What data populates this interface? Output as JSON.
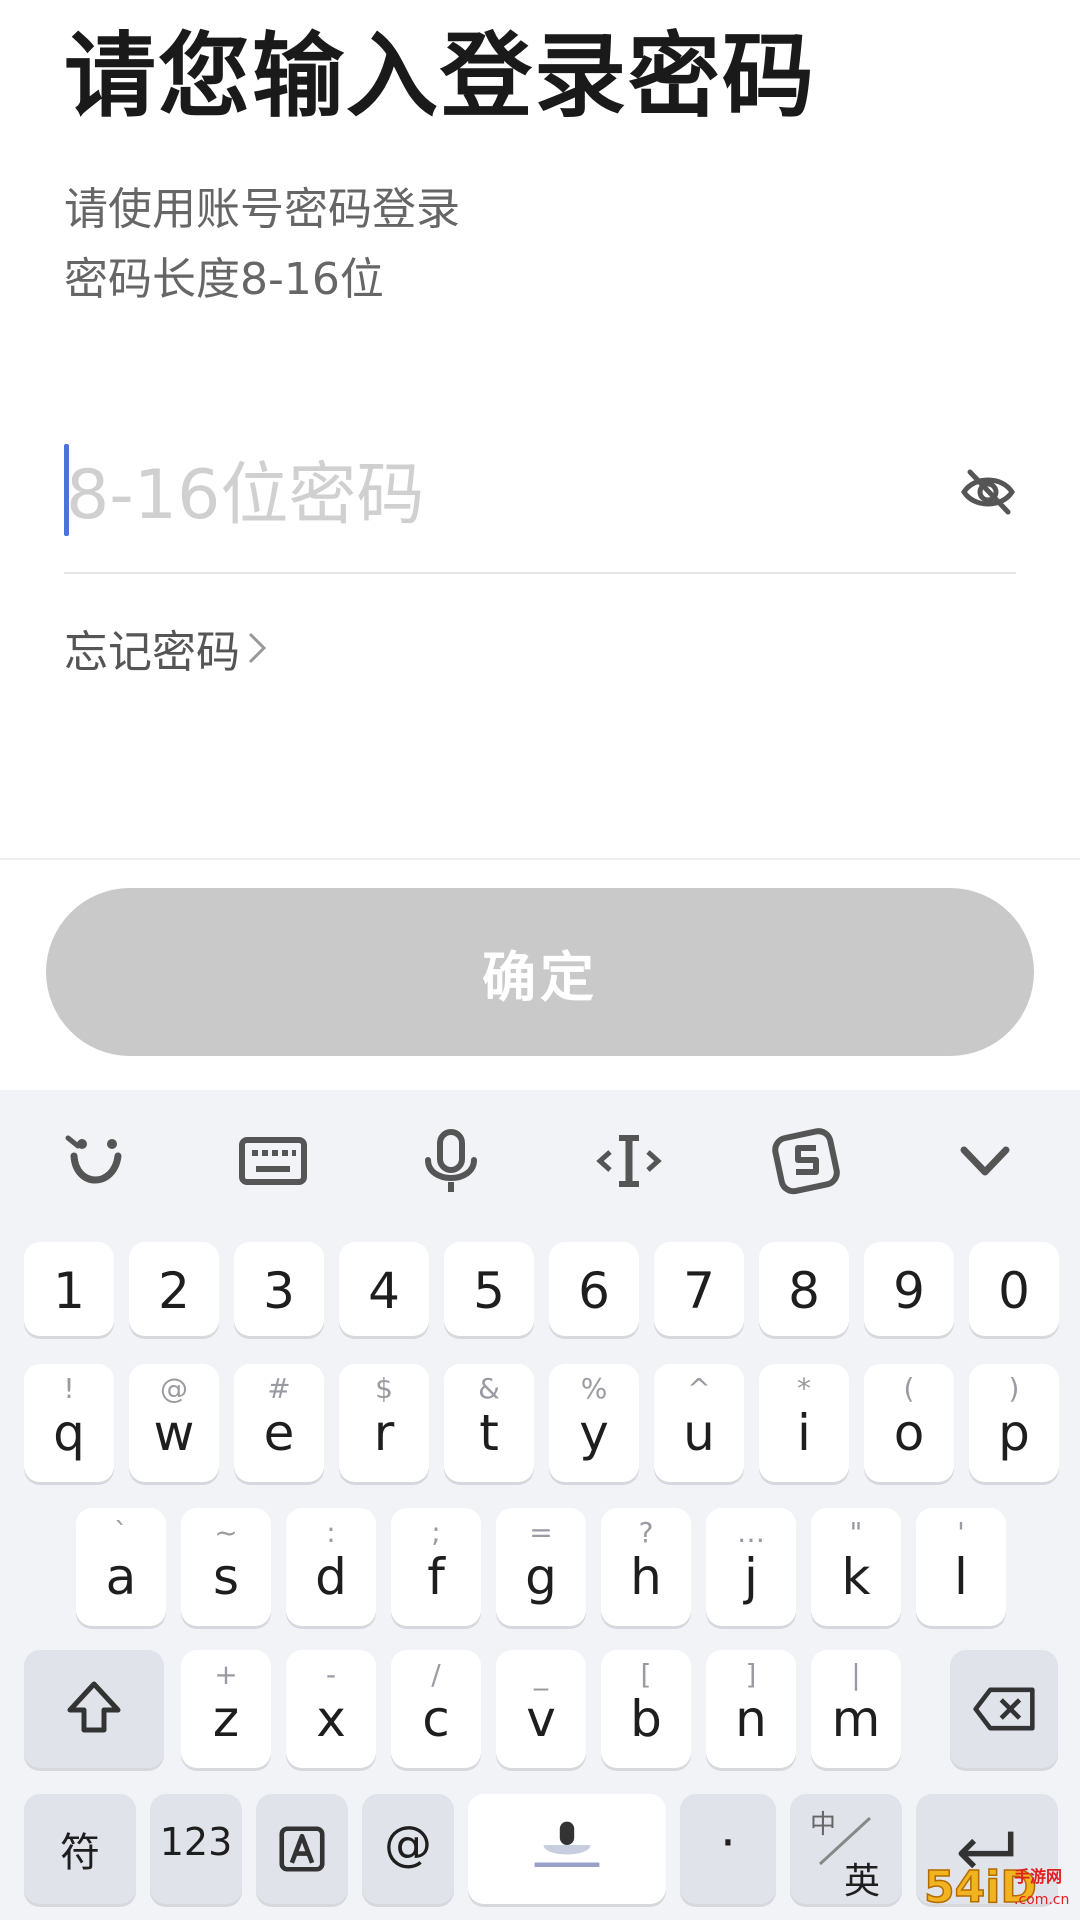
{
  "header": {
    "title": "请您输入登录密码",
    "subtitle_line1": "请使用账号密码登录",
    "subtitle_line2": "密码长度8-16位"
  },
  "password": {
    "placeholder": "8-16位密码",
    "value": ""
  },
  "forgot_label": "忘记密码",
  "confirm_label": "确定",
  "toolbar": [
    "emoji-icon",
    "keyboard-icon",
    "microphone-icon",
    "text-cursor-icon",
    "sogou-icon",
    "collapse-keyboard-icon"
  ],
  "keyboard": {
    "number_row": [
      "1",
      "2",
      "3",
      "4",
      "5",
      "6",
      "7",
      "8",
      "9",
      "0"
    ],
    "row1": [
      {
        "main": "q",
        "sec": "!"
      },
      {
        "main": "w",
        "sec": "@"
      },
      {
        "main": "e",
        "sec": "#"
      },
      {
        "main": "r",
        "sec": "$"
      },
      {
        "main": "t",
        "sec": "&"
      },
      {
        "main": "y",
        "sec": "%"
      },
      {
        "main": "u",
        "sec": "^"
      },
      {
        "main": "i",
        "sec": "*"
      },
      {
        "main": "o",
        "sec": "("
      },
      {
        "main": "p",
        "sec": ")"
      }
    ],
    "row2": [
      {
        "main": "a",
        "sec": "`"
      },
      {
        "main": "s",
        "sec": "~"
      },
      {
        "main": "d",
        "sec": ":"
      },
      {
        "main": "f",
        "sec": ";"
      },
      {
        "main": "g",
        "sec": "="
      },
      {
        "main": "h",
        "sec": "?"
      },
      {
        "main": "j",
        "sec": "…"
      },
      {
        "main": "k",
        "sec": "\""
      },
      {
        "main": "l",
        "sec": "'"
      }
    ],
    "row3": [
      {
        "main": "z",
        "sec": "+"
      },
      {
        "main": "x",
        "sec": "-"
      },
      {
        "main": "c",
        "sec": "/"
      },
      {
        "main": "v",
        "sec": "_"
      },
      {
        "main": "b",
        "sec": "["
      },
      {
        "main": "n",
        "sec": "]"
      },
      {
        "main": "m",
        "sec": "|"
      }
    ],
    "symbols_label": "符",
    "numbers_label": "123",
    "at_label": "@",
    "period_label": "·",
    "lang_top": "中",
    "lang_bottom": "英"
  },
  "watermark": {
    "text": "54iD",
    "sub": "手游网",
    "domain": ".com.cn"
  }
}
